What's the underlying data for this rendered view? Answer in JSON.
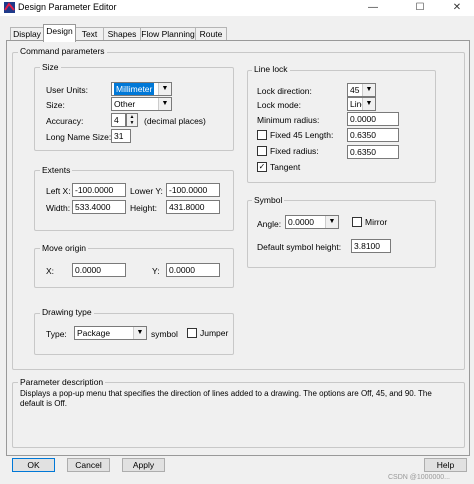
{
  "window": {
    "title": "Design Parameter Editor",
    "minimize": "—",
    "restore": "☐",
    "close": "✕"
  },
  "tabs": [
    "Display",
    "Design",
    "Text",
    "Shapes",
    "Flow Planning",
    "Route"
  ],
  "command_parameters": {
    "label": "Command parameters"
  },
  "size": {
    "label": "Size",
    "user_units_label": "User Units:",
    "user_units_value": "Millimeter",
    "size_label": "Size:",
    "size_value": "Other",
    "accuracy_label": "Accuracy:",
    "accuracy_value": "4",
    "accuracy_note": "(decimal places)",
    "long_name_label": "Long Name Size:",
    "long_name_value": "31"
  },
  "extents": {
    "label": "Extents",
    "left_x_label": "Left X:",
    "left_x_value": "-100.0000",
    "lower_y_label": "Lower Y:",
    "lower_y_value": "-100.0000",
    "width_label": "Width:",
    "width_value": "533.4000",
    "height_label": "Height:",
    "height_value": "431.8000"
  },
  "move_origin": {
    "label": "Move origin",
    "x_label": "X:",
    "x_value": "0.0000",
    "y_label": "Y:",
    "y_value": "0.0000"
  },
  "drawing_type": {
    "label": "Drawing type",
    "type_label": "Type:",
    "type_value": "Package",
    "symbol_label": "symbol",
    "jumper_label": "Jumper"
  },
  "line_lock": {
    "label": "Line lock",
    "direction_label": "Lock direction:",
    "direction_value": "45",
    "mode_label": "Lock mode:",
    "mode_value": "Line",
    "min_radius_label": "Minimum radius:",
    "min_radius_value": "0.0000",
    "fixed45_label": "Fixed 45 Length:",
    "fixed45_value": "0.6350",
    "fixed_radius_label": "Fixed radius:",
    "fixed_radius_value": "0.6350",
    "tangent_label": "Tangent",
    "tangent_checked": "✓"
  },
  "symbol": {
    "label": "Symbol",
    "angle_label": "Angle:",
    "angle_value": "0.0000",
    "mirror_label": "Mirror",
    "height_label": "Default symbol height:",
    "height_value": "3.8100"
  },
  "description": {
    "label": "Parameter description",
    "text": "Displays a pop-up menu that specifies the direction of lines added to a drawing. The options are Off, 45, and 90. The default is Off."
  },
  "buttons": {
    "ok": "OK",
    "cancel": "Cancel",
    "apply": "Apply",
    "help": "Help"
  },
  "watermark": "CSDN @1000000...",
  "colors": {
    "selection": "#0078d7",
    "panel": "#f0f0f0"
  }
}
